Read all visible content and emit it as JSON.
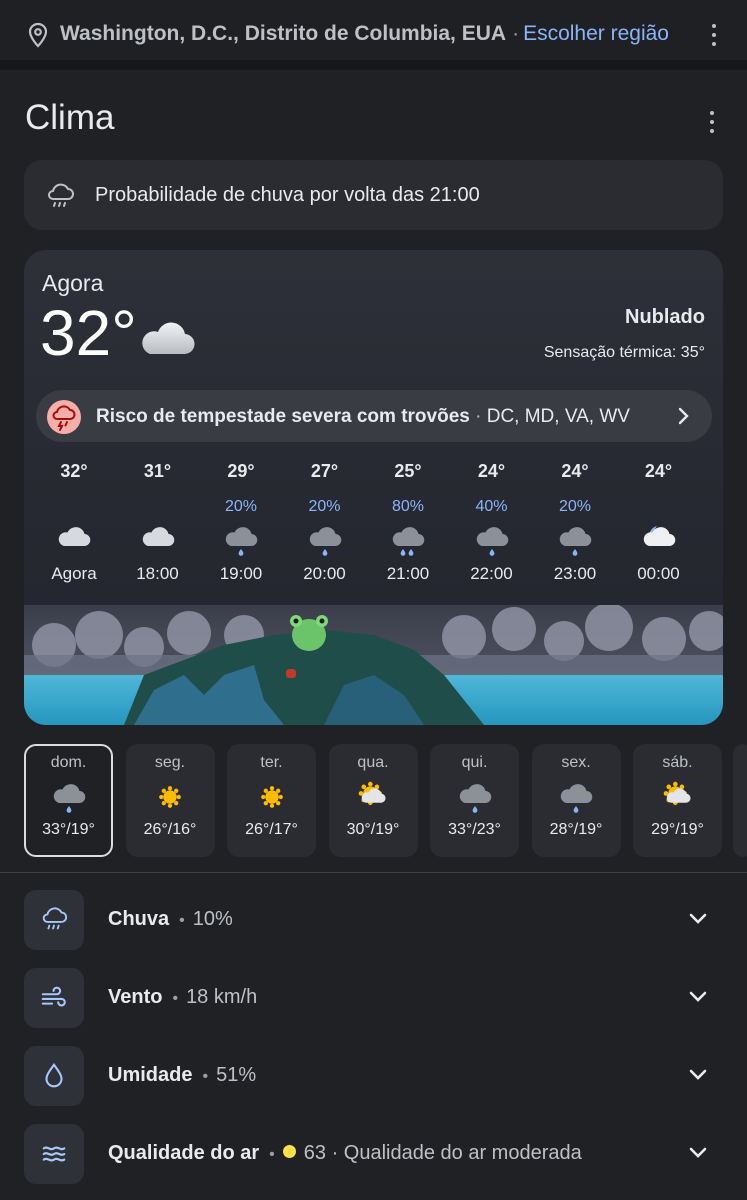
{
  "location": {
    "place": "Washington, D.C., Distrito de Columbia, EUA",
    "change_region": "Escolher região"
  },
  "header": {
    "title": "Clima"
  },
  "alert": {
    "text": "Probabilidade de chuva por volta das 21:00"
  },
  "current": {
    "label": "Agora",
    "temp": "32°",
    "condition": "Nublado",
    "feels_like": "Sensação térmica: 35°"
  },
  "storm": {
    "title": "Risco de tempestade severa com trovões",
    "regions": "DC, MD, VA, WV"
  },
  "hourly": [
    {
      "time": "Agora",
      "temp": "32°",
      "precip": "",
      "icon": "cloud-icon"
    },
    {
      "time": "18:00",
      "temp": "31°",
      "precip": "",
      "icon": "cloud-icon"
    },
    {
      "time": "19:00",
      "temp": "29°",
      "precip": "20%",
      "icon": "rain-light-icon"
    },
    {
      "time": "20:00",
      "temp": "27°",
      "precip": "20%",
      "icon": "rain-light-icon"
    },
    {
      "time": "21:00",
      "temp": "25°",
      "precip": "80%",
      "icon": "rain-heavy-icon"
    },
    {
      "time": "22:00",
      "temp": "24°",
      "precip": "40%",
      "icon": "rain-light-icon"
    },
    {
      "time": "23:00",
      "temp": "24°",
      "precip": "20%",
      "icon": "rain-light-icon"
    },
    {
      "time": "00:00",
      "temp": "24°",
      "precip": "",
      "icon": "moon-cloud-icon"
    }
  ],
  "daily": [
    {
      "day": "dom.",
      "temps": "33°/19°",
      "icon": "rain-light-icon",
      "selected": true
    },
    {
      "day": "seg.",
      "temps": "26°/16°",
      "icon": "sun-icon"
    },
    {
      "day": "ter.",
      "temps": "26°/17°",
      "icon": "sun-icon"
    },
    {
      "day": "qua.",
      "temps": "30°/19°",
      "icon": "sun-cloud-icon"
    },
    {
      "day": "qui.",
      "temps": "33°/23°",
      "icon": "rain-light-icon"
    },
    {
      "day": "sex.",
      "temps": "28°/19°",
      "icon": "rain-light-icon"
    },
    {
      "day": "sáb.",
      "temps": "29°/19°",
      "icon": "sun-cloud-icon"
    }
  ],
  "details": {
    "rain": {
      "label": "Chuva",
      "value": "10%"
    },
    "wind": {
      "label": "Vento",
      "value": "18 km/h"
    },
    "humidity": {
      "label": "Umidade",
      "value": "51%"
    },
    "air": {
      "label": "Qualidade do ar",
      "value": "63 · Qualidade do ar moderada"
    }
  },
  "colors": {
    "background": "#202124",
    "card": "#2a2c31",
    "accent_blue": "#8ab4f8",
    "storm_badge": "#f6aea9",
    "aq_moderate": "#fde047"
  }
}
